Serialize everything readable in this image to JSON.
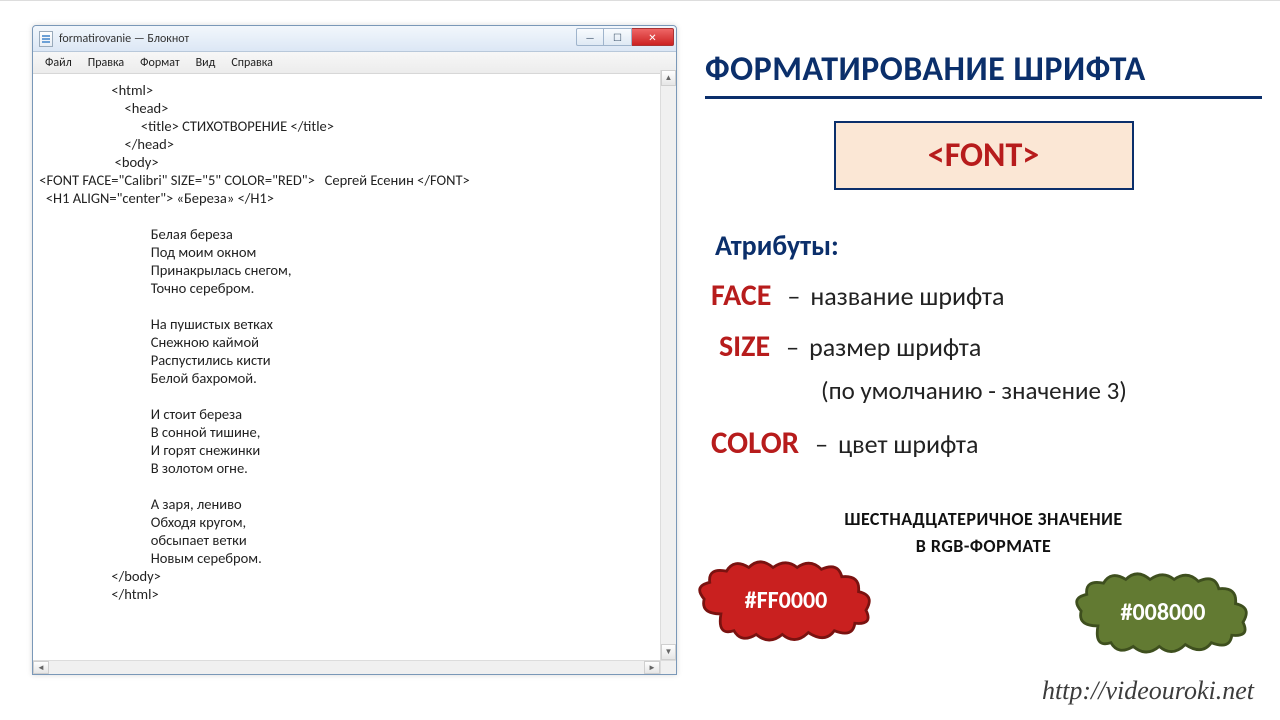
{
  "notepad": {
    "title": "formatirovanie — Блокнот",
    "menu": [
      "Файл",
      "Правка",
      "Формат",
      "Вид",
      "Справка"
    ],
    "content": "                       <html>\n                           <head>\n                                <title> СТИХОТВОРЕНИЕ </title>\n                           </head>\n                        <body>\n <FONT FACE=\"Calibri\" SIZE=\"5\" COLOR=\"RED\">   Сергей Есенин </FONT>\n   <H1 ALIGN=\"center\"> «Береза» </H1>\n\n                                   Белая береза\n                                   Под моим окном\n                                   Принакрылась снегом,\n                                   Точно серебром.\n\n                                   На пушистых ветках\n                                   Снежною каймой\n                                   Распустились кисти\n                                   Белой бахромой.\n\n                                   И стоит береза\n                                   В сонной тишине,\n                                   И горят снежинки\n                                   В золотом огне.\n\n                                   А заря, лениво\n                                   Обходя кругом,\n                                   обсыпает ветки\n                                   Новым серебром.\n                       </body>\n                       </html>"
  },
  "right": {
    "title": "ФОРМАТИРОВАНИЕ ШРИФТА",
    "tag": "<FONT>",
    "attrs_header": "Атрибуты:",
    "attributes": [
      {
        "name": "FACE",
        "desc": "название шрифта"
      },
      {
        "name": "SIZE",
        "desc": "размер шрифта"
      },
      {
        "name": "COLOR",
        "desc": "цвет шрифта"
      }
    ],
    "size_note": "(по умолчанию - значение 3)",
    "hex_header_l1": "ШЕСТНАДЦАТЕРИЧНОЕ  ЗНАЧЕНИЕ",
    "hex_header_l2": "В RGB-ФОРМАТЕ",
    "hex_red": "#FF0000",
    "hex_green": "#008000",
    "site": "http://videouroki.net"
  },
  "colors": {
    "accent_blue": "#0b2f6b",
    "accent_red": "#b71c1c",
    "cloud_red": "#c9201f",
    "cloud_green": "#627a32"
  }
}
